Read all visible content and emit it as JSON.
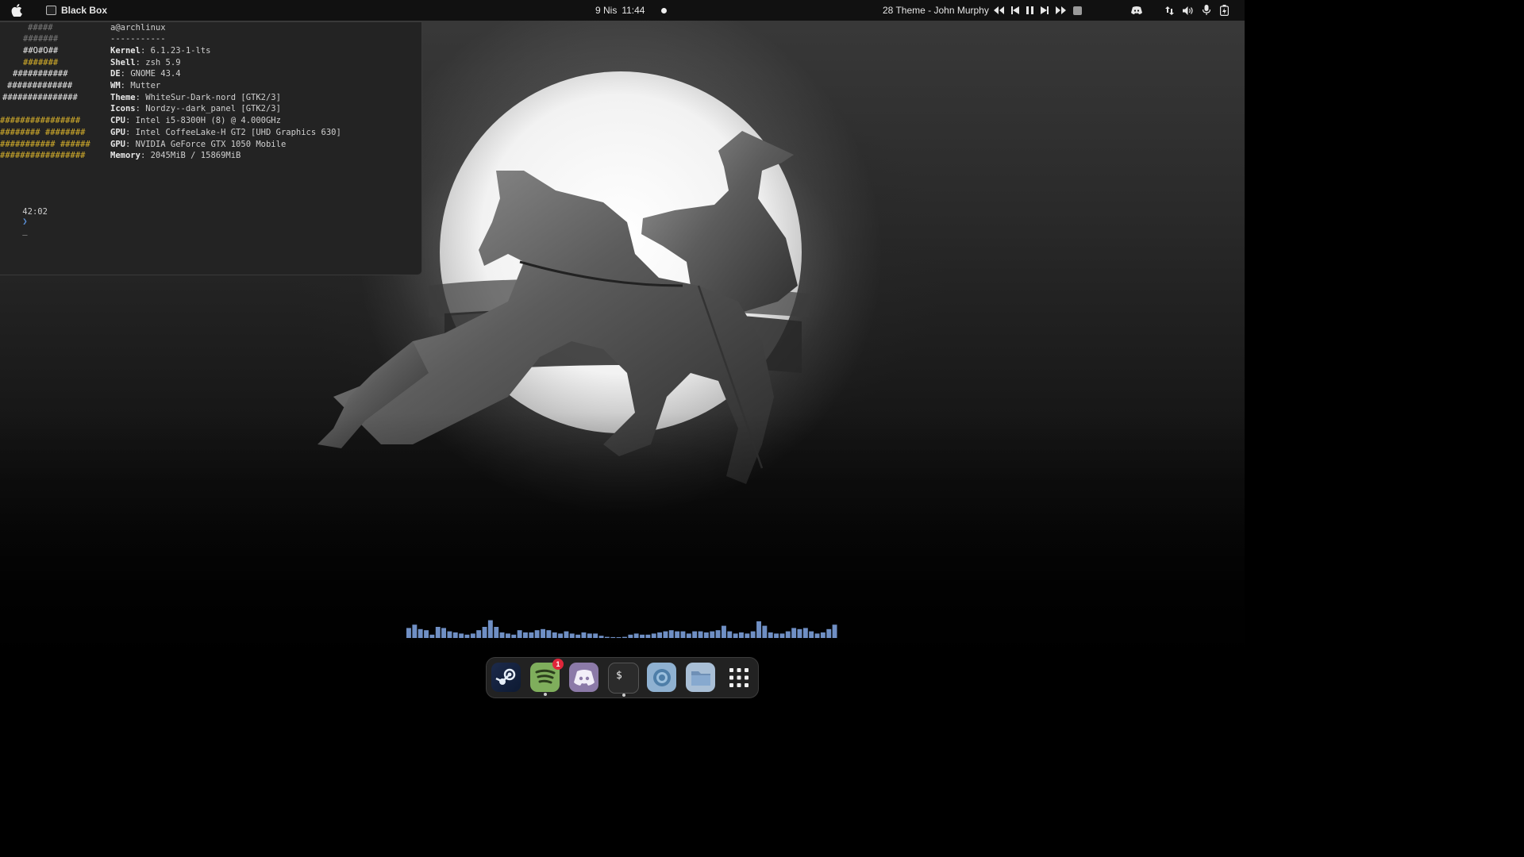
{
  "topbar": {
    "app_title": "Black Box",
    "date": "9 Nis",
    "time": "11:44",
    "now_playing": "28 Theme - John Murphy"
  },
  "terminal": {
    "host": "a@archlinux",
    "separator": "-----------",
    "info": [
      {
        "key": "Kernel",
        "value": "6.1.23-1-lts"
      },
      {
        "key": "Shell",
        "value": "zsh 5.9"
      },
      {
        "key": "DE",
        "value": "GNOME 43.4"
      },
      {
        "key": "WM",
        "value": "Mutter"
      },
      {
        "key": "Theme",
        "value": "WhiteSur-Dark-nord [GTK2/3]"
      },
      {
        "key": "Icons",
        "value": "Nordzy--dark_panel [GTK2/3]"
      },
      {
        "key": "CPU",
        "value": "Intel i5-8300H (8) @ 4.000GHz"
      },
      {
        "key": "GPU",
        "value": "Intel CoffeeLake-H GT2 [UHD Graphics 630]"
      },
      {
        "key": "GPU",
        "value": "NVIDIA GeForce GTX 1050 Mobile"
      },
      {
        "key": "Memory",
        "value": "2045MiB / 15869MiB"
      }
    ],
    "ascii_art": [
      "#####",
      "#######",
      "##O#O##",
      "#######",
      "###########",
      "#############",
      "###############",
      "################",
      "######## ########",
      "########### ######",
      "#################"
    ],
    "prompt_time": "42:02",
    "prompt_symbol": "❯",
    "cursor": "_"
  },
  "dock": {
    "apps": [
      {
        "name": "Steam",
        "icon": "steam-icon"
      },
      {
        "name": "Spotify",
        "icon": "spotify-icon",
        "badge": "1"
      },
      {
        "name": "Discord",
        "icon": "discord-icon"
      },
      {
        "name": "Black Box",
        "icon": "terminal-icon",
        "glyph": "$"
      },
      {
        "name": "Browser",
        "icon": "browser-icon"
      },
      {
        "name": "Files",
        "icon": "folder-icon"
      },
      {
        "name": "Show Applications",
        "icon": "app-grid-icon"
      }
    ]
  },
  "colors": {
    "accent_blue": "#5a8fd6",
    "ascii_yellow": "#d8b12b",
    "badge_red": "#e0263a",
    "visualizer": "#6f8fc4"
  },
  "visualizer_levels": [
    0.45,
    0.6,
    0.4,
    0.35,
    0.15,
    0.5,
    0.45,
    0.3,
    0.25,
    0.2,
    0.15,
    0.2,
    0.35,
    0.5,
    0.8,
    0.5,
    0.25,
    0.2,
    0.15,
    0.35,
    0.25,
    0.25,
    0.35,
    0.4,
    0.35,
    0.25,
    0.2,
    0.3,
    0.2,
    0.15,
    0.25,
    0.2,
    0.2,
    0.1,
    0.05,
    0.04,
    0.03,
    0.05,
    0.15,
    0.2,
    0.15,
    0.15,
    0.2,
    0.25,
    0.3,
    0.35,
    0.3,
    0.3,
    0.2,
    0.3,
    0.3,
    0.25,
    0.3,
    0.35,
    0.55,
    0.3,
    0.2,
    0.25,
    0.2,
    0.3,
    0.75,
    0.55,
    0.25,
    0.2,
    0.2,
    0.3,
    0.45,
    0.4,
    0.45,
    0.3,
    0.2,
    0.25,
    0.4,
    0.6
  ]
}
